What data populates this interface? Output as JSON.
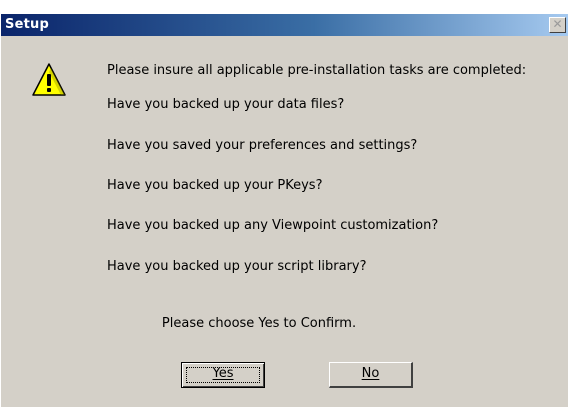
{
  "window": {
    "title": "Setup",
    "close_glyph": "✕"
  },
  "icon": "warning-icon",
  "message": {
    "intro": "Please insure all applicable pre-installation tasks are completed:",
    "questions": [
      "Have you backed up your data files?",
      "Have you saved your preferences and settings?",
      "Have you backed up your PKeys?",
      "Have you backed up any Viewpoint customization?",
      "Have you backed up your script library?"
    ],
    "confirm": "Please choose Yes to Confirm."
  },
  "buttons": {
    "yes_label": "Yes",
    "no_label": "No"
  },
  "colors": {
    "dialog_background": "#d4d0c8",
    "titlebar_start": "#0a246a",
    "titlebar_end": "#a6caf0",
    "warning_yellow": "#ffff00"
  }
}
